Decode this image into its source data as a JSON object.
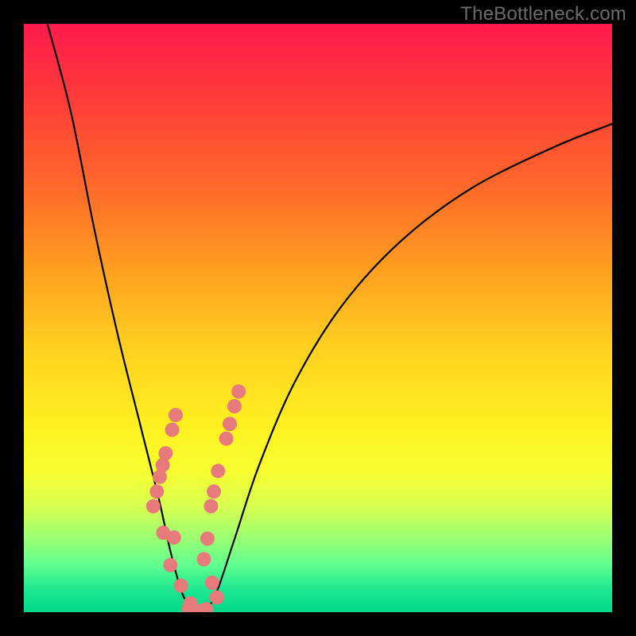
{
  "watermark": "TheBottleneck.com",
  "chart_data": {
    "type": "line",
    "title": "",
    "xlabel": "",
    "ylabel": "",
    "ylim": [
      0,
      100
    ],
    "x_range": [
      0,
      100
    ],
    "curves": [
      {
        "name": "left-branch",
        "points": [
          {
            "x": 4,
            "y": 100
          },
          {
            "x": 8,
            "y": 85
          },
          {
            "x": 12,
            "y": 65
          },
          {
            "x": 16,
            "y": 47
          },
          {
            "x": 20,
            "y": 31
          },
          {
            "x": 23,
            "y": 19
          },
          {
            "x": 25,
            "y": 10
          },
          {
            "x": 27,
            "y": 3
          },
          {
            "x": 29,
            "y": 0
          }
        ]
      },
      {
        "name": "right-branch",
        "points": [
          {
            "x": 31,
            "y": 0
          },
          {
            "x": 33,
            "y": 4
          },
          {
            "x": 36,
            "y": 13
          },
          {
            "x": 40,
            "y": 25
          },
          {
            "x": 46,
            "y": 39
          },
          {
            "x": 54,
            "y": 52
          },
          {
            "x": 64,
            "y": 63
          },
          {
            "x": 76,
            "y": 72
          },
          {
            "x": 90,
            "y": 79
          },
          {
            "x": 100,
            "y": 83
          }
        ]
      }
    ],
    "dot_clusters": [
      {
        "name": "left-dots",
        "points": [
          {
            "x": 25.8,
            "y": 33.5
          },
          {
            "x": 25.2,
            "y": 31.0
          },
          {
            "x": 24.1,
            "y": 27.0
          },
          {
            "x": 23.6,
            "y": 25.0
          },
          {
            "x": 23.1,
            "y": 23.0
          },
          {
            "x": 22.6,
            "y": 20.5
          },
          {
            "x": 22.0,
            "y": 18.0
          },
          {
            "x": 23.7,
            "y": 13.5
          },
          {
            "x": 25.5,
            "y": 12.7
          },
          {
            "x": 24.9,
            "y": 8.0
          },
          {
            "x": 26.7,
            "y": 4.5
          },
          {
            "x": 28.3,
            "y": 1.5
          }
        ]
      },
      {
        "name": "right-dots",
        "points": [
          {
            "x": 36.5,
            "y": 37.5
          },
          {
            "x": 35.8,
            "y": 35.0
          },
          {
            "x": 35.0,
            "y": 32.0
          },
          {
            "x": 34.4,
            "y": 29.5
          },
          {
            "x": 33.0,
            "y": 24.0
          },
          {
            "x": 32.3,
            "y": 20.5
          },
          {
            "x": 31.8,
            "y": 18.0
          },
          {
            "x": 31.2,
            "y": 12.5
          },
          {
            "x": 30.6,
            "y": 9.0
          },
          {
            "x": 32.0,
            "y": 5.0
          },
          {
            "x": 32.8,
            "y": 2.5
          }
        ]
      },
      {
        "name": "bottom-bridge",
        "points": [
          {
            "x": 28.0,
            "y": 0.5
          },
          {
            "x": 29.0,
            "y": 0.2
          },
          {
            "x": 30.0,
            "y": 0.2
          },
          {
            "x": 31.0,
            "y": 0.5
          }
        ]
      }
    ],
    "colors": {
      "dot": "#e77a7a",
      "curve": "#000000",
      "gradient_top": "#ff1a4d",
      "gradient_bottom": "#00d88a"
    }
  }
}
